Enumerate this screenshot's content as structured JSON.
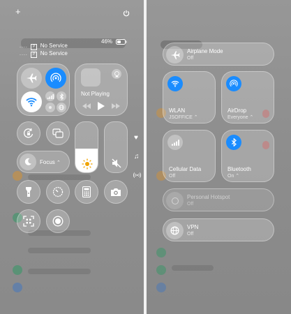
{
  "left": {
    "status": {
      "carrier1": "No Service",
      "carrier2": "No Service",
      "battery": "46%"
    },
    "media": {
      "label": "Not Playing"
    },
    "focus": {
      "label": "Focus"
    }
  },
  "right": {
    "airplane": {
      "title": "Airplane Mode",
      "state": "Off"
    },
    "wlan": {
      "title": "WLAN",
      "state": "JSOFFICE"
    },
    "airdrop": {
      "title": "AirDrop",
      "state": "Everyone"
    },
    "cellular": {
      "title": "Cellular Data",
      "state": "Off"
    },
    "bluetooth": {
      "title": "Bluetooth",
      "state": "On"
    },
    "hotspot": {
      "title": "Personal Hotspot",
      "state": "Off"
    },
    "vpn": {
      "title": "VPN",
      "state": "Off"
    }
  },
  "colors": {
    "accent": "#1a8cff",
    "tile": "rgba(255,255,255,0.22)"
  },
  "levels": {
    "brightness": 0.47,
    "volume": 0.0
  }
}
